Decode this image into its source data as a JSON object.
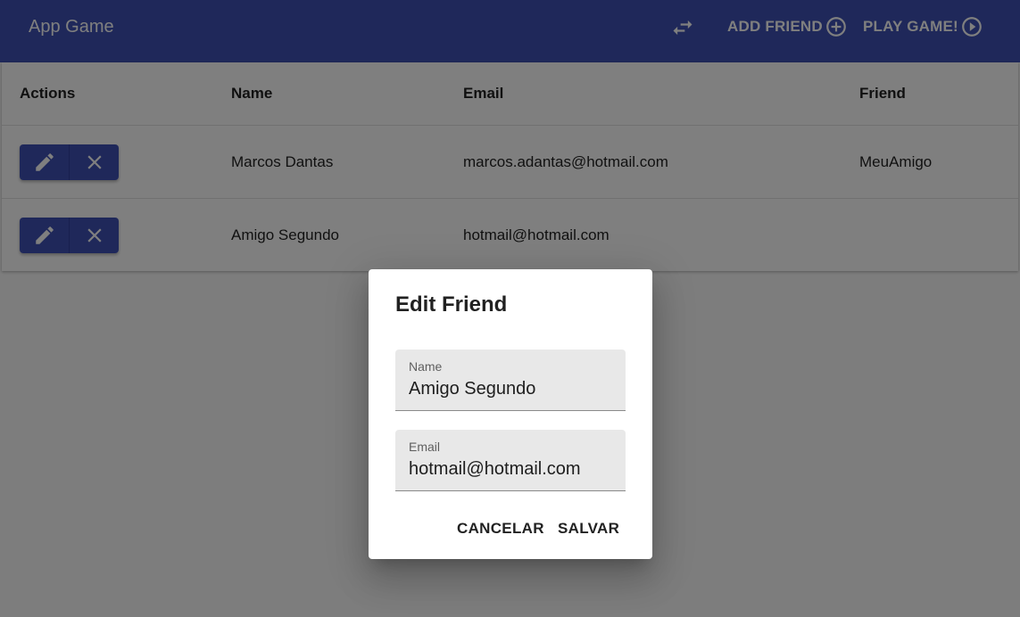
{
  "appbar": {
    "title": "App Game",
    "swap_icon": "swap-horiz-icon",
    "add_friend_label": "ADD FRIEND",
    "add_friend_icon": "add-circle-icon",
    "play_game_label": "PLAY GAME!",
    "play_game_icon": "play-circle-icon"
  },
  "table": {
    "headers": {
      "actions": "Actions",
      "name": "Name",
      "email": "Email",
      "friend": "Friend"
    },
    "rows": [
      {
        "name": "Marcos Dantas",
        "email": "marcos.adantas@hotmail.com",
        "friend": "MeuAmigo",
        "edit_icon": "pencil-icon",
        "delete_icon": "close-icon"
      },
      {
        "name": "Amigo Segundo",
        "email": "hotmail@hotmail.com",
        "friend": "",
        "edit_icon": "pencil-icon",
        "delete_icon": "close-icon"
      }
    ]
  },
  "dialog": {
    "title": "Edit Friend",
    "name_label": "Name",
    "name_value": "Amigo Segundo",
    "email_label": "Email",
    "email_value": "hotmail@hotmail.com",
    "cancel_label": "CANCELAR",
    "save_label": "SALVAR"
  },
  "colors": {
    "primary": "#3f51b5",
    "backdrop": "rgba(0,0,0,0.5)",
    "field_bg": "#e8e8e8"
  }
}
